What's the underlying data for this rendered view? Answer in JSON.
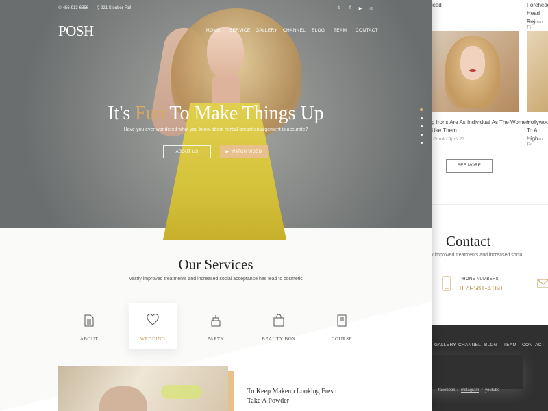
{
  "topbar": {
    "phone": "456-913-6856",
    "address": "921 Steuber Fall",
    "social_icons": [
      "twitter-icon",
      "facebook-icon",
      "youtube-icon",
      "instagram-icon"
    ],
    "social_glyphs": [
      "t",
      "f",
      "▶",
      "◎"
    ]
  },
  "logo": "POSH",
  "nav": [
    "HOME",
    "SERVICE",
    "GALLERY",
    "CHANNEL",
    "BLOG",
    "TEAM",
    "CONTACT"
  ],
  "hero": {
    "title_before": "It's ",
    "title_accent": "Fun",
    "title_after": " To Make Things Up",
    "subtitle": "Have you ever wondered what you know about herbal breast enlargement is accurate?",
    "btn_about": "ABOUT US",
    "btn_video": "WATCH VIDEO",
    "slide_count": 5,
    "active_slide": 1
  },
  "services": {
    "title": "Our Services",
    "subtitle": "Vastly improved treatments and increased social acceptance has lead to cosmetic",
    "items": [
      {
        "label": "ABOUT",
        "icon": "document-icon"
      },
      {
        "label": "WEDDING",
        "icon": "heart-icon",
        "active": true
      },
      {
        "label": "PARTY",
        "icon": "cake-icon"
      },
      {
        "label": "BEAUTY BOX",
        "icon": "shopping-bag-icon"
      },
      {
        "label": "COURSE",
        "icon": "book-icon"
      }
    ]
  },
  "blog_preview": {
    "title_line1": "To Keep Makeup Looking Fresh",
    "title_line2": "Take A Powder"
  },
  "right_page": {
    "card1_top": "iced",
    "card2_top_line1": "Forehead",
    "card2_top_line2": "Head Rej",
    "card2_top_meta": "Eugenia Fi",
    "card1_line1": "g Irons Are As Individual As The Women",
    "card1_line2": "Use Them",
    "card1_meta": "Frank / April 22",
    "card2_line1": "Hollywoo",
    "card2_line2": "To A High",
    "card2_meta": "Eugenia Fr",
    "see_more": "SEE MORE",
    "contact_title": "Contact",
    "contact_sub": "lly improved treatments and increased social",
    "phone_label": "PHONE NUMBERS",
    "phone_number": "059-581-4160",
    "footer_nav": [
      "GALLERY",
      "CHANNEL",
      "BLOG",
      "TEAM",
      "CONTACT"
    ],
    "footer_links": [
      "facebook",
      "instagram",
      "youtube"
    ],
    "footer_sep": "/"
  }
}
